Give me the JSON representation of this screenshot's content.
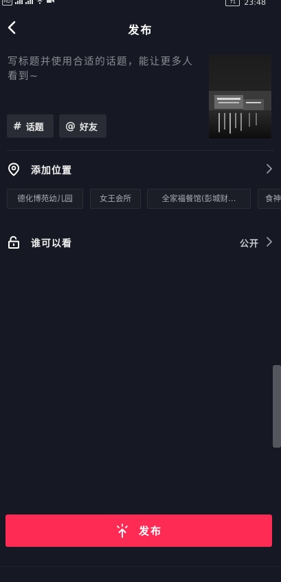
{
  "status_bar": {
    "left_tag": "HD",
    "time": "23:48",
    "battery": "71"
  },
  "header": {
    "title": "发布"
  },
  "caption": {
    "placeholder": "写标题并使用合适的话题，能让更多人看到~"
  },
  "chips": {
    "topic": {
      "symbol": "#",
      "label": "话题"
    },
    "friend": {
      "symbol": "@",
      "label": "好友"
    }
  },
  "location": {
    "label": "添加位置",
    "suggestions": [
      "德化博苑幼儿园",
      "女王会所",
      "全家福餐馆(彭城财…",
      "食神"
    ]
  },
  "visibility": {
    "label": "谁可以看",
    "value": "公开"
  },
  "publish_button": {
    "label": "发布"
  },
  "icons": {
    "back": "chevron-left-icon",
    "location": "location-pin-icon",
    "lock": "unlock-icon",
    "publish": "spark-upload-icon"
  },
  "colors": {
    "background": "#161823",
    "accent": "#fe2c55",
    "chip_bg": "#2a2c35"
  }
}
